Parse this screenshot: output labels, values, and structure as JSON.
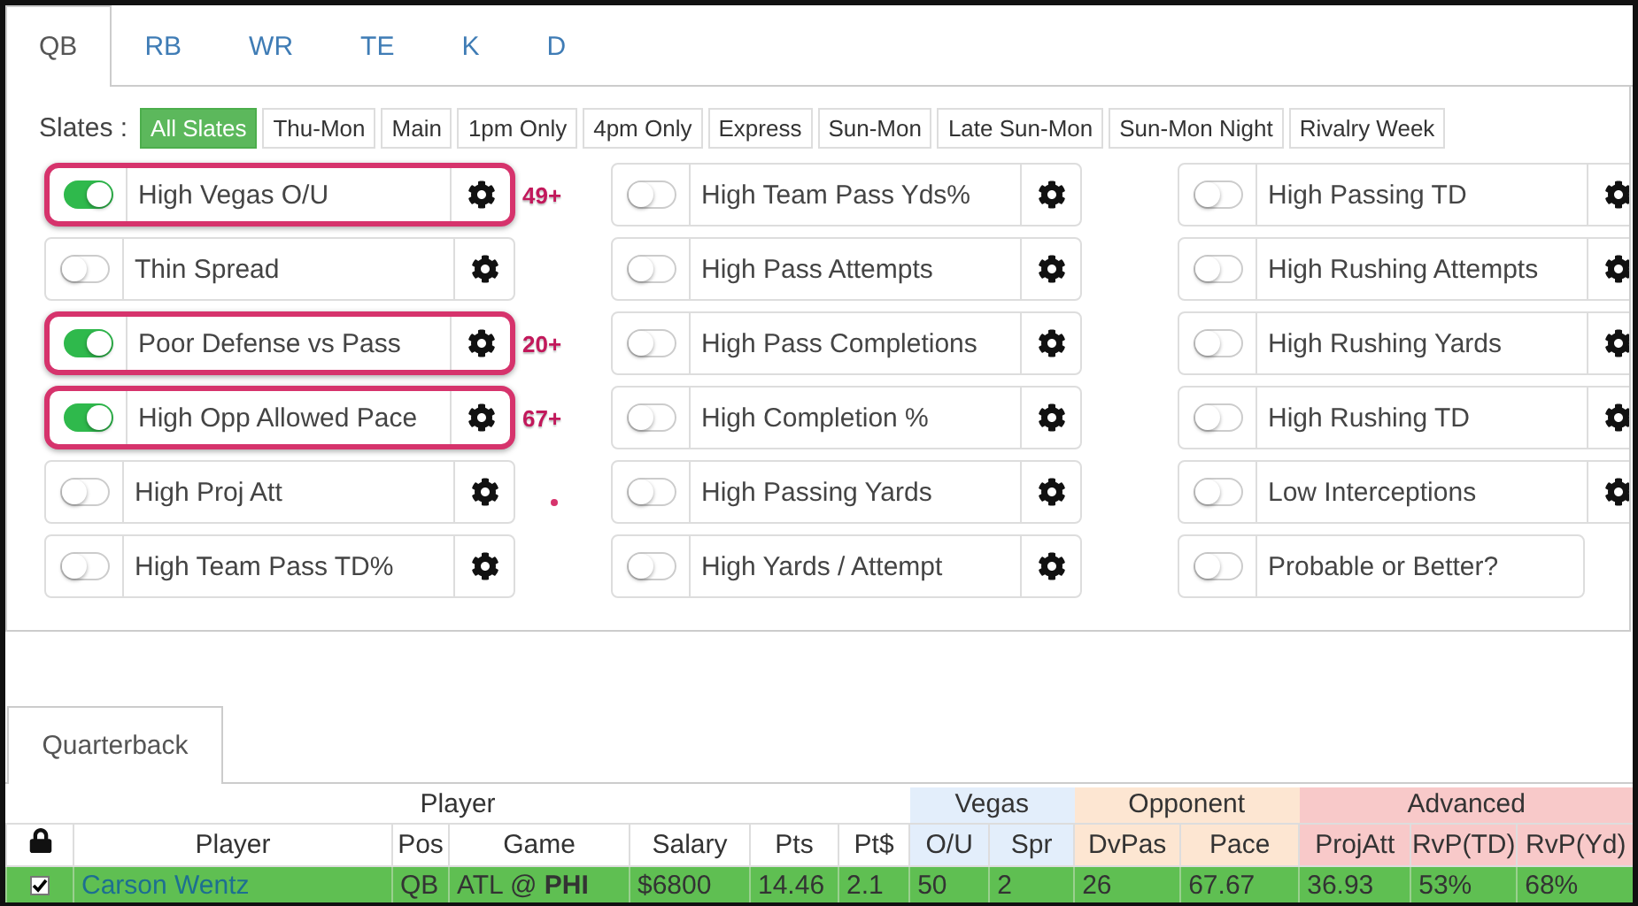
{
  "tabs": [
    {
      "label": "QB",
      "selected": true
    },
    {
      "label": "RB",
      "selected": false
    },
    {
      "label": "WR",
      "selected": false
    },
    {
      "label": "TE",
      "selected": false
    },
    {
      "label": "K",
      "selected": false
    },
    {
      "label": "D",
      "selected": false
    }
  ],
  "slates_label": "Slates :",
  "slates": [
    {
      "label": "All Slates",
      "selected": true
    },
    {
      "label": "Thu-Mon",
      "selected": false
    },
    {
      "label": "Main",
      "selected": false
    },
    {
      "label": "1pm Only",
      "selected": false
    },
    {
      "label": "4pm Only",
      "selected": false
    },
    {
      "label": "Express",
      "selected": false
    },
    {
      "label": "Sun-Mon",
      "selected": false
    },
    {
      "label": "Late Sun-Mon",
      "selected": false
    },
    {
      "label": "Sun-Mon Night",
      "selected": false
    },
    {
      "label": "Rivalry Week",
      "selected": false
    }
  ],
  "filter_columns": [
    [
      {
        "label": "High Vegas O/U",
        "on": true,
        "settings": true,
        "highlighted": true,
        "note": "49+"
      },
      {
        "label": "Thin Spread",
        "on": false,
        "settings": true,
        "highlighted": false
      },
      {
        "label": "Poor Defense vs Pass",
        "on": true,
        "settings": true,
        "highlighted": true,
        "note": "20+"
      },
      {
        "label": "High Opp Allowed Pace",
        "on": true,
        "settings": true,
        "highlighted": true,
        "note": "67+"
      },
      {
        "label": "High Proj Att",
        "on": false,
        "settings": true,
        "highlighted": false,
        "dot": true
      },
      {
        "label": "High Team Pass TD%",
        "on": false,
        "settings": true,
        "highlighted": false
      }
    ],
    [
      {
        "label": "High Team Pass Yds%",
        "on": false,
        "settings": true,
        "highlighted": false
      },
      {
        "label": "High Pass Attempts",
        "on": false,
        "settings": true,
        "highlighted": false
      },
      {
        "label": "High Pass Completions",
        "on": false,
        "settings": true,
        "highlighted": false
      },
      {
        "label": "High Completion %",
        "on": false,
        "settings": true,
        "highlighted": false
      },
      {
        "label": "High Passing Yards",
        "on": false,
        "settings": true,
        "highlighted": false
      },
      {
        "label": "High Yards / Attempt",
        "on": false,
        "settings": true,
        "highlighted": false
      }
    ],
    [
      {
        "label": "High Passing TD",
        "on": false,
        "settings": true,
        "highlighted": false
      },
      {
        "label": "High Rushing Attempts",
        "on": false,
        "settings": true,
        "highlighted": false
      },
      {
        "label": "High Rushing Yards",
        "on": false,
        "settings": true,
        "highlighted": false
      },
      {
        "label": "High Rushing TD",
        "on": false,
        "settings": true,
        "highlighted": false
      },
      {
        "label": "Low Interceptions",
        "on": false,
        "settings": true,
        "highlighted": false
      },
      {
        "label": "Probable or Better?",
        "on": false,
        "settings": false,
        "highlighted": false
      }
    ]
  ],
  "table_tab": {
    "label": "Quarterback",
    "selected": true
  },
  "table": {
    "groups": [
      {
        "label": "Player",
        "kind": "player",
        "columns": [
          "Player",
          "Pos",
          "Game",
          "Salary",
          "Pts",
          "Pt$"
        ]
      },
      {
        "label": "Vegas",
        "kind": "vegas",
        "columns": [
          "O/U",
          "Spr"
        ]
      },
      {
        "label": "Opponent",
        "kind": "opponent",
        "columns": [
          "DvPas",
          "Pace"
        ]
      },
      {
        "label": "Advanced",
        "kind": "advanced",
        "columns": [
          "ProjAtt",
          "RvP(TD)",
          "RvP(Yd)"
        ]
      }
    ],
    "rows": [
      {
        "checked": true,
        "selected": true,
        "cells": [
          "Carson Wentz",
          "QB",
          "ATL @ **PHI**",
          "$6800",
          "14.46",
          "2.1",
          "50",
          "2",
          "26",
          "67.67",
          "36.93",
          "53%",
          "68%"
        ]
      }
    ]
  }
}
